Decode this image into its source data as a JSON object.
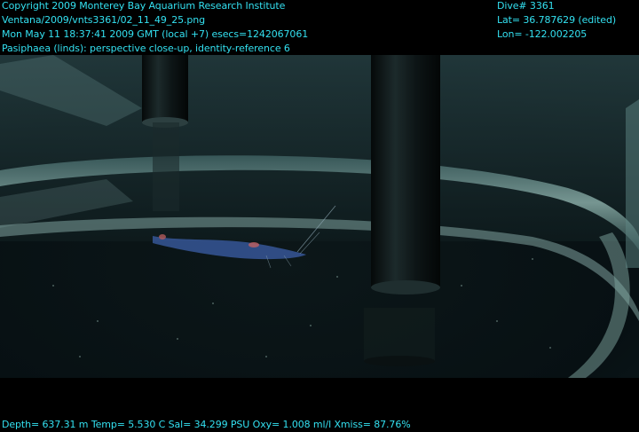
{
  "overlay": {
    "header_left": [
      "Copyright 2009 Monterey Bay Aquarium Research Institute",
      "Ventana/2009/vnts3361/02_11_49_25.png",
      "Mon May 11 18:37:41 2009 GMT (local +7)  esecs=1242067061",
      "Pasiphaea (linds): perspective close-up, identity-reference 6"
    ],
    "header_right": [
      "Dive# 3361",
      "Lat= 36.787629 (edited)",
      "Lon= -122.002205"
    ],
    "footer": "Depth= 637.31 m  Temp= 5.530 C  Sal= 34.299 PSU  Oxy= 1.008 ml/l  Xmiss= 87.76%"
  },
  "colors": {
    "overlay_text": "#33e0f0",
    "background": "#000000",
    "water": "#0a1418",
    "cylinder_edge": "#6f9a9a"
  },
  "scene": {
    "subject": "shrimp-specimen",
    "objects": [
      "left-rod-icon",
      "right-rod-icon",
      "container-ring",
      "shrimp-icon"
    ]
  }
}
